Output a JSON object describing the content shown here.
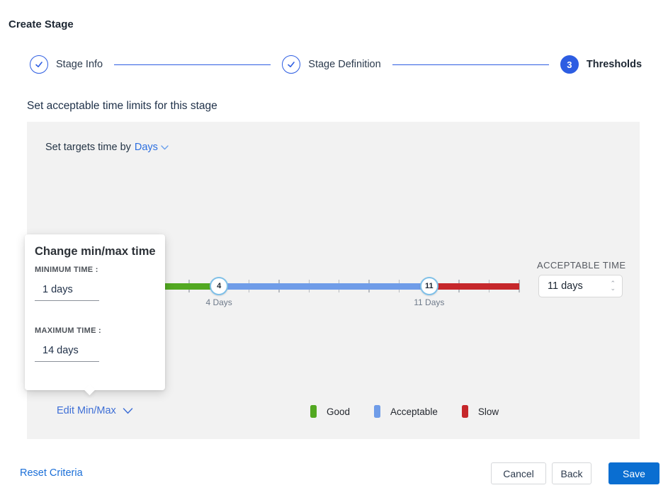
{
  "page": {
    "title": "Create Stage"
  },
  "stepper": {
    "steps": [
      {
        "label": "Stage Info",
        "state": "complete"
      },
      {
        "label": "Stage Definition",
        "state": "complete"
      },
      {
        "label": "Thresholds",
        "state": "active",
        "number": "3"
      }
    ]
  },
  "section": {
    "heading": "Set acceptable time limits for this stage"
  },
  "panel": {
    "target_prefix": "Set targets time by",
    "target_value": "Days",
    "slider": {
      "min_day": 1,
      "max_day": 14,
      "handles": [
        {
          "value": 4,
          "label": "4 Days"
        },
        {
          "value": 11,
          "label": "11 Days"
        }
      ],
      "segment_colors": {
        "good": "#52a821",
        "acceptable": "#6f9ce8",
        "slow": "#c6272b"
      }
    },
    "acceptable_time": {
      "label": "ACCEPTABLE TIME",
      "value": "11 days"
    },
    "edit_link": "Edit Min/Max",
    "legend": [
      {
        "label": "Good",
        "color": "#52a821"
      },
      {
        "label": "Acceptable",
        "color": "#6f9ce8"
      },
      {
        "label": "Slow",
        "color": "#c6272b"
      }
    ]
  },
  "popover": {
    "title": "Change min/max time",
    "min_label": "MINIMUM TIME :",
    "min_value": "1 days",
    "max_label": "MAXIMUM TIME :",
    "max_value": "14 days"
  },
  "footer": {
    "reset": "Reset Criteria",
    "cancel": "Cancel",
    "back": "Back",
    "save": "Save"
  },
  "colors": {
    "accent_blue": "#2d5de2",
    "link_blue": "#1b6fd8",
    "save_blue": "#0a6ed1",
    "handle_ring": "#7fc0e8",
    "panel_bg": "#f2f2f2"
  }
}
